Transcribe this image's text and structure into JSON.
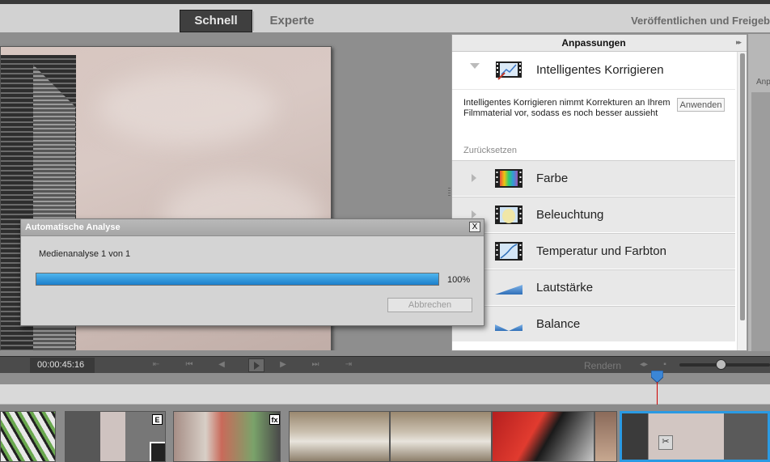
{
  "topbar": {
    "mode_quick": "Schnell",
    "mode_expert": "Experte",
    "publish": "Veröffentlichen und Freigeb"
  },
  "adjustments": {
    "title": "Anpassungen",
    "smart_fix": {
      "label": "Intelligentes Korrigieren",
      "description": "Intelligentes Korrigieren nimmt Korrekturen an Ihrem Filmmaterial vor, sodass es noch besser aussieht",
      "apply_label": "Anwenden",
      "reset_label": "Zurücksetzen"
    },
    "items": [
      {
        "label": "Farbe",
        "icon": "color-filmstrip-icon"
      },
      {
        "label": "Beleuchtung",
        "icon": "lighting-filmstrip-icon"
      },
      {
        "label": "Temperatur und Farbton",
        "icon": "temperature-curve-icon"
      },
      {
        "label": "Lautstärke",
        "icon": "volume-ramp-icon"
      },
      {
        "label": "Balance",
        "icon": "balance-icon"
      }
    ]
  },
  "right_panel": {
    "label": "Anp"
  },
  "transport": {
    "timecode": "00:00:45:16",
    "render_label": "Rendern",
    "zoom_level": 0.45
  },
  "timeline": {
    "clip_badges": [
      "E",
      "fx"
    ]
  },
  "dialog": {
    "title": "Automatische Analyse",
    "close_label": "X",
    "status": "Medienanalyse  1 von 1",
    "progress_percent": 100,
    "progress_label": "100%",
    "cancel_label": "Abbrechen"
  },
  "colors": {
    "progress_blue": "#1c7fcb",
    "playhead_red": "#cc0000",
    "playhead_blue": "#3b86d6"
  }
}
